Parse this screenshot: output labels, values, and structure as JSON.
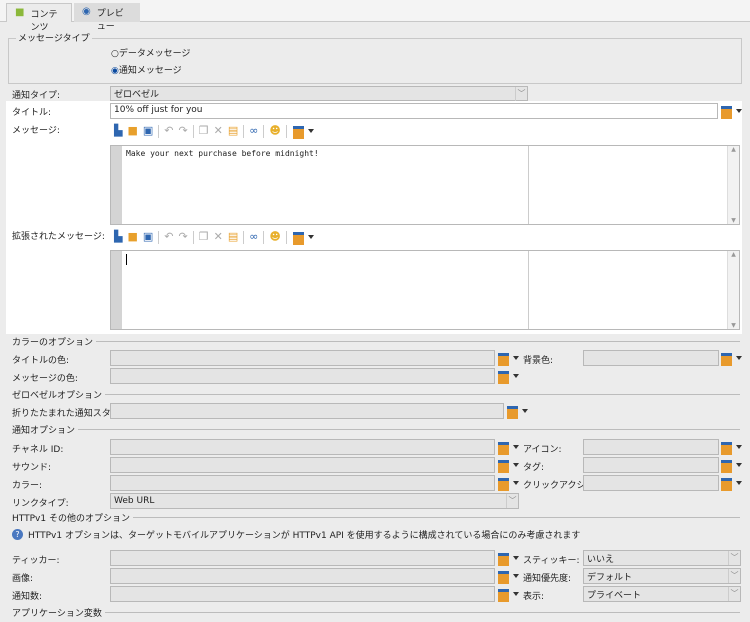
{
  "tabs": [
    {
      "label": "コンテンツ",
      "icon": "android-icon"
    },
    {
      "label": "プレビュー",
      "icon": "eye-icon"
    }
  ],
  "message_type": {
    "legend": "メッセージタイプ",
    "options": [
      {
        "label": "データメッセージ",
        "selected": false
      },
      {
        "label": "通知メッセージ",
        "selected": true
      }
    ]
  },
  "notification_type": {
    "label": "通知タイプ:",
    "value": "ゼロベゼル"
  },
  "title": {
    "label": "タイトル:",
    "value": "10% off just for you"
  },
  "message": {
    "label": "メッセージ:",
    "value": "Make your next purchase before midnight!"
  },
  "extended_message": {
    "label": "拡張されたメッセージ:",
    "value": ""
  },
  "color_options": {
    "header": "カラーのオプション",
    "title_color": "タイトルの色:",
    "message_color": "メッセージの色:",
    "background_color": "背景色:"
  },
  "zero_bezel": {
    "header": "ゼロベゼルオプション",
    "collapsed_style": "折りたたまれた通知スタイル:"
  },
  "notification_options": {
    "header": "通知オプション",
    "channel_id": "チャネル ID:",
    "sound": "サウンド:",
    "color": "カラー:",
    "link_type": "リンクタイプ:",
    "link_type_value": "Web URL",
    "icon": "アイコン:",
    "tag": "タグ:",
    "click_action": "クリックアクション:"
  },
  "httpv1": {
    "header": "HTTPv1 その他のオプション",
    "info": "HTTPv1 オプションは、ターゲットモバイルアプリケーションが HTTPv1 API を使用するように構成されている場合にのみ考慮されます",
    "ticker": "ティッカー:",
    "image": "画像:",
    "count": "通知数:",
    "sticky": "スティッキー:",
    "sticky_value": "いいえ",
    "priority": "通知優先度:",
    "priority_value": "デフォルト",
    "visibility": "表示:",
    "visibility_value": "プライベート"
  },
  "app_vars": {
    "header": "アプリケーション変数"
  }
}
